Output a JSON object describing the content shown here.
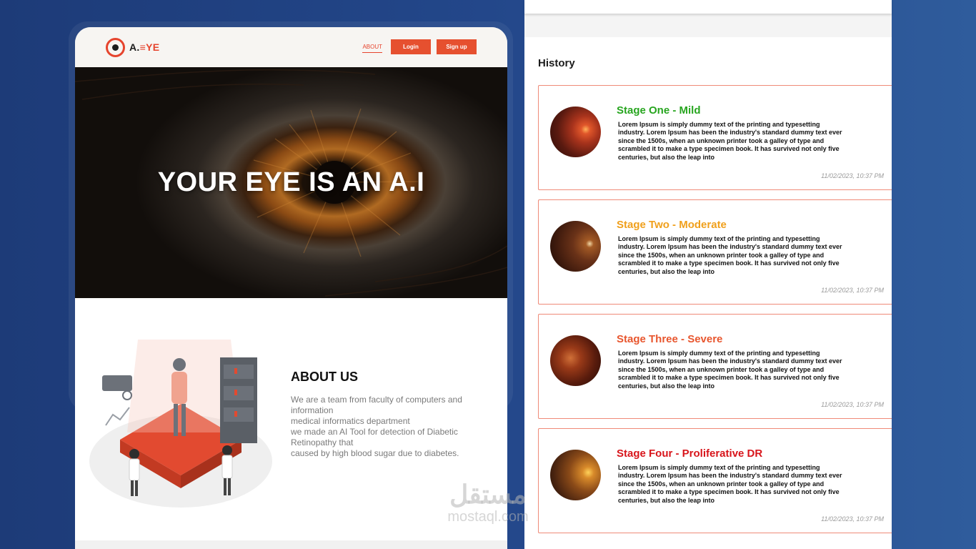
{
  "nav": {
    "logo_text_1": "A.",
    "logo_text_2": "≡YE",
    "about": "ABOUT",
    "login": "Login",
    "signup": "Sign up"
  },
  "hero": {
    "title": "YOUR EYE IS AN A.I"
  },
  "about": {
    "title": "ABOUT US",
    "lines": [
      "We are a team from faculty of computers and",
      "information",
      "medical informatics department",
      "we made an AI Tool for detection of Diabetic",
      "Retinopathy that",
      "caused by high blood sugar due to diabetes."
    ]
  },
  "history": {
    "title": "History",
    "items": [
      {
        "stage": "Stage One - Mild",
        "color": "#27a51f",
        "text": "Lorem Ipsum is simply dummy text of the printing and typesetting industry. Lorem Ipsum has been the industry's standard dummy text ever since the 1500s, when an unknown printer took a galley of type and scrambled it to make a type specimen book. It has survived not only five centuries, but also the leap into",
        "date": "11/02/2023, 10:37 PM"
      },
      {
        "stage": "Stage Two - Moderate",
        "color": "#f0a01c",
        "text": "Lorem Ipsum is simply dummy text of the printing and typesetting industry. Lorem Ipsum has been the industry's standard dummy text ever since the 1500s, when an unknown printer took a galley of type and scrambled it to make a type specimen book. It has survived not only five centuries, but also the leap into",
        "date": "11/02/2023, 10:37 PM"
      },
      {
        "stage": "Stage Three - Severe",
        "color": "#e8562e",
        "text": "Lorem Ipsum is simply dummy text of the printing and typesetting industry. Lorem Ipsum has been the industry's standard dummy text ever since the 1500s, when an unknown printer took a galley of type and scrambled it to make a type specimen book. It has survived not only five centuries, but also the leap into",
        "date": "11/02/2023, 10:37 PM"
      },
      {
        "stage": "Stage Four - Proliferative DR",
        "color": "#d8151b",
        "text": "Lorem Ipsum is simply dummy text of the printing and typesetting industry. Lorem Ipsum has been the industry's standard dummy text ever since the 1500s, when an unknown printer took a galley of type and scrambled it to make a type specimen book. It has survived not only five centuries, but also the leap into",
        "date": "11/02/2023, 10:37 PM"
      }
    ]
  },
  "watermark": {
    "arabic": "مستقل",
    "latin": "mostaql.com"
  }
}
